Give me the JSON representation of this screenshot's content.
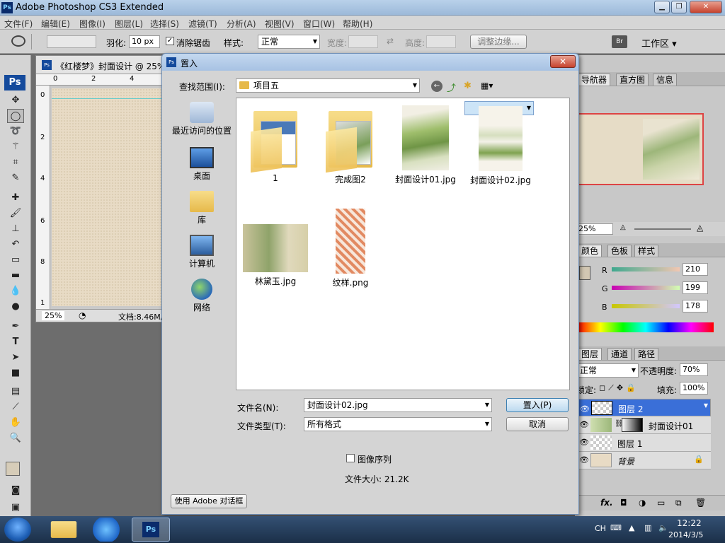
{
  "app": {
    "title": "Adobe Photoshop CS3 Extended",
    "logo": "Ps"
  },
  "menu": [
    "文件(F)",
    "编辑(E)",
    "图像(I)",
    "图层(L)",
    "选择(S)",
    "滤镜(T)",
    "分析(A)",
    "视图(V)",
    "窗口(W)",
    "帮助(H)"
  ],
  "options": {
    "feather_label": "羽化:",
    "feather_value": "10 px",
    "antialias_label": "消除锯齿",
    "style_label": "样式:",
    "style_value": "正常",
    "width_label": "宽度:",
    "height_label": "高度:",
    "refine_label": "调整边缘...",
    "workspace_label": "工作区 ▾"
  },
  "document": {
    "tab_title": "《红楼梦》封面设计 @ 25%",
    "zoom": "25%",
    "doc_info": "文档:8.46M/",
    "ruler_top": [
      "0",
      "2",
      "4"
    ],
    "ruler_left": [
      "0",
      "2",
      "4",
      "6",
      "8",
      "1"
    ]
  },
  "panels": {
    "nav_tabs": [
      "导航器",
      "直方图",
      "信息"
    ],
    "nav_zoom": "25%",
    "color_tabs": [
      "颜色",
      "色板",
      "样式"
    ],
    "color": {
      "r_label": "R",
      "g_label": "G",
      "b_label": "B",
      "r": "210",
      "g": "199",
      "b": "178",
      "swatch": "#d2c7b2"
    },
    "layer_tabs": [
      "图层",
      "通道",
      "路径"
    ],
    "blend_mode": "正常",
    "opacity_label": "不透明度:",
    "opacity_value": "70%",
    "lock_label": "锁定:",
    "fill_label": "填充:",
    "fill_value": "100%",
    "layers": [
      {
        "name": "图层 2",
        "selected": true
      },
      {
        "name": "封面设计01",
        "selected": false
      },
      {
        "name": "图层 1",
        "selected": false
      },
      {
        "name": "背景",
        "selected": false
      }
    ]
  },
  "dialog": {
    "title": "置入",
    "lookin_label": "查找范围(I):",
    "lookin_value": "项目五",
    "places": [
      "最近访问的位置",
      "桌面",
      "库",
      "计算机",
      "网络"
    ],
    "files": [
      {
        "name": "1",
        "kind": "folder"
      },
      {
        "name": "完成图2",
        "kind": "folder"
      },
      {
        "name": "封面设计01.jpg",
        "kind": "image"
      },
      {
        "name": "封面设计02.jpg",
        "kind": "image",
        "selected": true
      },
      {
        "name": "林黛玉.jpg",
        "kind": "image"
      },
      {
        "name": "纹样.png",
        "kind": "image"
      }
    ],
    "filename_label": "文件名(N):",
    "filename_value": "封面设计02.jpg",
    "filetype_label": "文件类型(T):",
    "filetype_value": "所有格式",
    "place_button": "置入(P)",
    "cancel_button": "取消",
    "sequence_label": "图像序列",
    "filesize_label": "文件大小: 21.2K",
    "adobe_dialog_button": "使用 Adobe 对话框"
  },
  "taskbar": {
    "lang": "CH",
    "time": "12:22",
    "date": "2014/3/5"
  }
}
